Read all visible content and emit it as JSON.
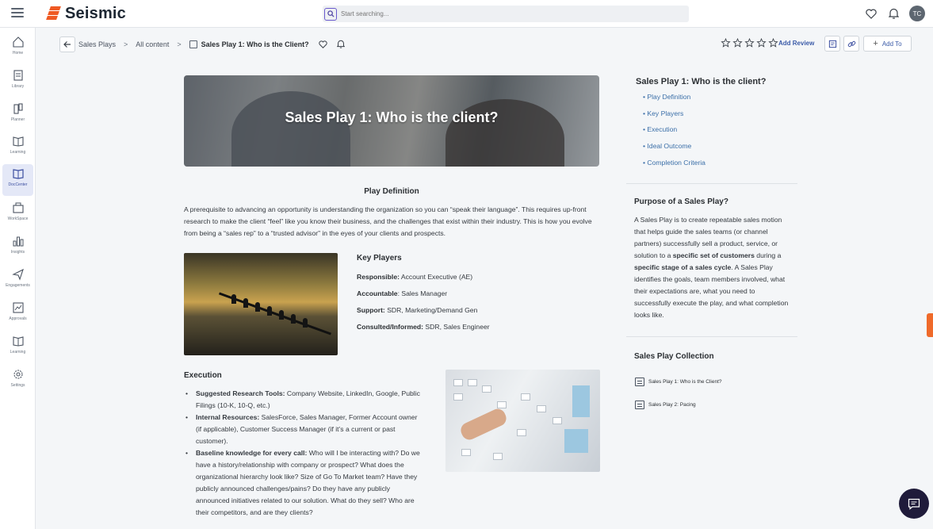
{
  "app": {
    "brand": "Seismic",
    "brand_color": "#ef5a23",
    "accent_color": "#3b5ba8"
  },
  "search": {
    "placeholder": "Start searching..."
  },
  "user": {
    "initials": "TC"
  },
  "sidebar": {
    "items": [
      {
        "label": "Home",
        "icon": "home-icon"
      },
      {
        "label": "Library",
        "icon": "library-icon"
      },
      {
        "label": "Planner",
        "icon": "planner-icon"
      },
      {
        "label": "Learning",
        "icon": "learning-icon"
      },
      {
        "label": "DocCenter",
        "icon": "doccenter-icon",
        "active": true
      },
      {
        "label": "WorkSpace",
        "icon": "workspace-icon"
      },
      {
        "label": "Insights",
        "icon": "insights-icon"
      },
      {
        "label": "Engagements",
        "icon": "engagements-icon"
      },
      {
        "label": "Approvals",
        "icon": "approvals-icon"
      },
      {
        "label": "Learning",
        "icon": "learning-icon"
      },
      {
        "label": "Settings",
        "icon": "settings-icon"
      }
    ]
  },
  "breadcrumb": {
    "items": [
      "Sales Plays",
      "All content"
    ],
    "current": "Sales Play 1: Who is the Client?"
  },
  "toolbar": {
    "rating": 0,
    "add_review": "Add Review",
    "add_to": "Add To"
  },
  "hero": {
    "title": "Sales Play 1: Who is the client?"
  },
  "definition": {
    "title": "Play Definition",
    "text": "A prerequisite to advancing an opportunity is understanding the organization so you can “speak their language”. This requires up-front research to make the client  “feel” like you know their business, and the challenges that exist within their industry. This is how you evolve from being a “sales rep” to a “trusted advisor” in the eyes  of your clients and prospects."
  },
  "key_players": {
    "title": "Key Players",
    "rows": [
      {
        "label": "Responsible:",
        "value": " Account Executive (AE)"
      },
      {
        "label": "Accountable",
        "value": ": Sales Manager"
      },
      {
        "label": "Support:",
        "value": " SDR, Marketing/Demand Gen"
      },
      {
        "label": "Consulted/Informed:",
        "value": " SDR, Sales Engineer"
      }
    ]
  },
  "execution": {
    "title": "Execution",
    "items": [
      {
        "label": "Suggested Research Tools:",
        "text": " Company Website, LinkedIn, Google, Public Filings (10-K, 10-Q, etc.)"
      },
      {
        "label": "Internal Resources:",
        "text": " SalesForce, Sales Manager, Former Account owner (if applicable), Customer Success Manager (if it’s a current or past customer)."
      },
      {
        "label": "Baseline knowledge for every call:",
        "text": " Who will I be interacting with? Do we have a history/relationship with company or prospect? What does the organizational hierarchy look like? Size of Go To Market team? Have they publicly announced challenges/pains? Do they have any publicly announced initiatives related to our solution. What do they sell? Who are their competitors, and are they clients?"
      }
    ]
  },
  "toc": {
    "title": "Sales Play 1: Who is the client?",
    "items": [
      "Play Definition",
      "Key Players",
      "Execution",
      "Ideal Outcome",
      "Completion Criteria"
    ]
  },
  "purpose": {
    "title": "Purpose of a Sales Play?",
    "part1": "A Sales Play is to create repeatable sales motion that helps guide the sales teams (or channel partners) successfully sell a product, service, or solution to a ",
    "bold1": "specific set of customers",
    "part2": " during a ",
    "bold2": "specific stage of a sales cycle",
    "part3": ". A Sales Play identifies the goals, team members involved, what their expectations are, what you need to successfully execute the play, and what completion looks like."
  },
  "collection": {
    "title": "Sales Play Collection",
    "items": [
      "Sales Play 1: Who is the Client?",
      "Sales Play 2: Pacing"
    ]
  }
}
